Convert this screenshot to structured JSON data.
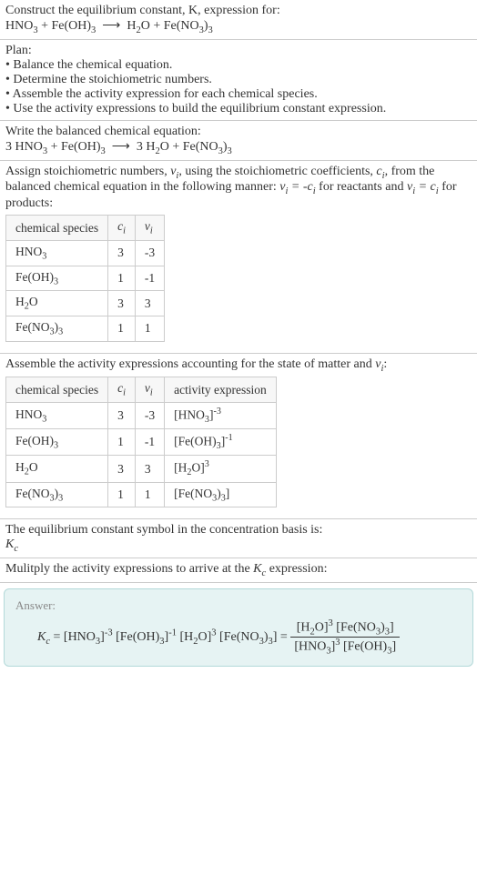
{
  "q": {
    "prompt": "Construct the equilibrium constant, K, expression for:",
    "equation": "HNO₃ + Fe(OH)₃ ⟶ H₂O + Fe(NO₃)₃"
  },
  "plan": {
    "heading": "Plan:",
    "items": [
      "Balance the chemical equation.",
      "Determine the stoichiometric numbers.",
      "Assemble the activity expression for each chemical species.",
      "Use the activity expressions to build the equilibrium constant expression."
    ]
  },
  "balanced": {
    "heading": "Write the balanced chemical equation:",
    "equation": "3 HNO₃ + Fe(OH)₃ ⟶ 3 H₂O + Fe(NO₃)₃"
  },
  "stoich": {
    "text_a": "Assign stoichiometric numbers, ",
    "text_b": ", using the stoichiometric coefficients, ",
    "text_c": ", from the balanced chemical equation in the following manner: ",
    "text_d": " for reactants and ",
    "text_e": " for products:",
    "head_species": "chemical species",
    "head_ci": "cᵢ",
    "head_vi": "νᵢ",
    "rows": [
      {
        "sp": "HNO₃",
        "c": "3",
        "v": "-3"
      },
      {
        "sp": "Fe(OH)₃",
        "c": "1",
        "v": "-1"
      },
      {
        "sp": "H₂O",
        "c": "3",
        "v": "3"
      },
      {
        "sp": "Fe(NO₃)₃",
        "c": "1",
        "v": "1"
      }
    ]
  },
  "activity": {
    "heading": "Assemble the activity expressions accounting for the state of matter and νᵢ:",
    "head_species": "chemical species",
    "head_ci": "cᵢ",
    "head_vi": "νᵢ",
    "head_act": "activity expression",
    "rows": [
      {
        "sp": "HNO₃",
        "c": "3",
        "v": "-3",
        "a": "[HNO₃]⁻³"
      },
      {
        "sp": "Fe(OH)₃",
        "c": "1",
        "v": "-1",
        "a": "[Fe(OH)₃]⁻¹"
      },
      {
        "sp": "H₂O",
        "c": "3",
        "v": "3",
        "a": "[H₂O]³"
      },
      {
        "sp": "Fe(NO₃)₃",
        "c": "1",
        "v": "1",
        "a": "[Fe(NO₃)₃]"
      }
    ]
  },
  "symbol": {
    "text": "The equilibrium constant symbol in the concentration basis is:",
    "sym": "K_c"
  },
  "multiply": {
    "text": "Mulitply the activity expressions to arrive at the K_c expression:"
  },
  "answer": {
    "label": "Answer:",
    "lhs": "K_c = [HNO₃]⁻³ [Fe(OH)₃]⁻¹ [H₂O]³ [Fe(NO₃)₃] = ",
    "num": "[H₂O]³ [Fe(NO₃)₃]",
    "den": "[HNO₃]³ [Fe(OH)₃]"
  }
}
